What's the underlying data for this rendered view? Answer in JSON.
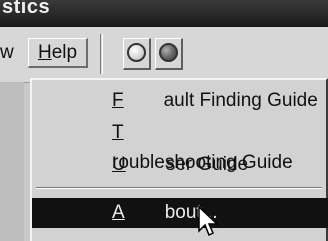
{
  "window": {
    "title_fragment": "stics"
  },
  "menubar": {
    "cut_item": "w",
    "help": {
      "accel": "H",
      "rest": "elp"
    }
  },
  "toolbar": {
    "buttons": [
      {
        "icon": "empty-circle-icon"
      },
      {
        "icon": "filled-circle-icon"
      }
    ]
  },
  "help_menu": {
    "items": [
      {
        "accel": "F",
        "rest": "ault Finding Guide",
        "selected": false
      },
      {
        "accel": "T",
        "rest": "roubleshooting Guide",
        "selected": false
      },
      {
        "accel": "U",
        "rest": "ser Guide",
        "selected": false
      },
      {
        "accel": "A",
        "rest": "bout...",
        "selected": true
      }
    ]
  },
  "colors": {
    "selection_bg": "#111111",
    "menu_bg": "#d2d2d2"
  }
}
